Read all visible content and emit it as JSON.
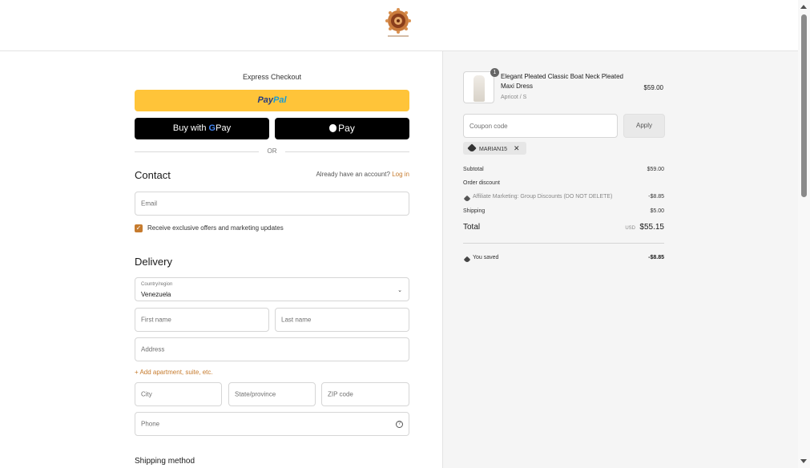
{
  "header": {
    "logo": "store-logo"
  },
  "express": {
    "title": "Express Checkout",
    "paypal_part1": "Pay",
    "paypal_part2": "Pal",
    "gpay_label": "Buy with",
    "gpay_g": "G",
    "gpay_pay": "Pay",
    "apay_label": "Pay",
    "or_label": "OR"
  },
  "contact": {
    "title": "Contact",
    "account_prompt": "Already have an account?",
    "login_label": "Log in",
    "email_placeholder": "Email",
    "marketing_label": "Receive exclusive offers and marketing updates",
    "marketing_checked": true
  },
  "delivery": {
    "title": "Delivery",
    "country_label": "Country/region",
    "country_value": "Venezuela",
    "first_name_placeholder": "First name",
    "last_name_placeholder": "Last name",
    "address_placeholder": "Address",
    "add_apartment_label": "Add apartment, suite, etc.",
    "city_placeholder": "City",
    "state_placeholder": "State/province",
    "zip_placeholder": "ZIP code",
    "phone_placeholder": "Phone"
  },
  "shipping": {
    "title": "Shipping method"
  },
  "order": {
    "product": {
      "name": "Elegant Pleated Classic Boat Neck Pleated Maxi Dress",
      "variant": "Apricot / S",
      "price": "$59.00",
      "quantity": "1"
    },
    "coupon_placeholder": "Coupon code",
    "apply_label": "Apply",
    "applied_code": "MARIAN15",
    "subtotal_label": "Subtotal",
    "subtotal_value": "$59.00",
    "order_discount_label": "Order discount",
    "discount_name": "Affiliate Marketing: Group Discounts (DO NOT DELETE)",
    "discount_value": "-$8.85",
    "shipping_label": "Shipping",
    "shipping_value": "$5.00",
    "total_label": "Total",
    "total_currency": "USD",
    "total_value": "$55.15",
    "saved_label": "You saved",
    "saved_value": "-$8.85"
  },
  "colors": {
    "accent": "#c67b2e",
    "paypal_yellow": "#ffc439",
    "summary_bg": "#f5f5f5"
  }
}
